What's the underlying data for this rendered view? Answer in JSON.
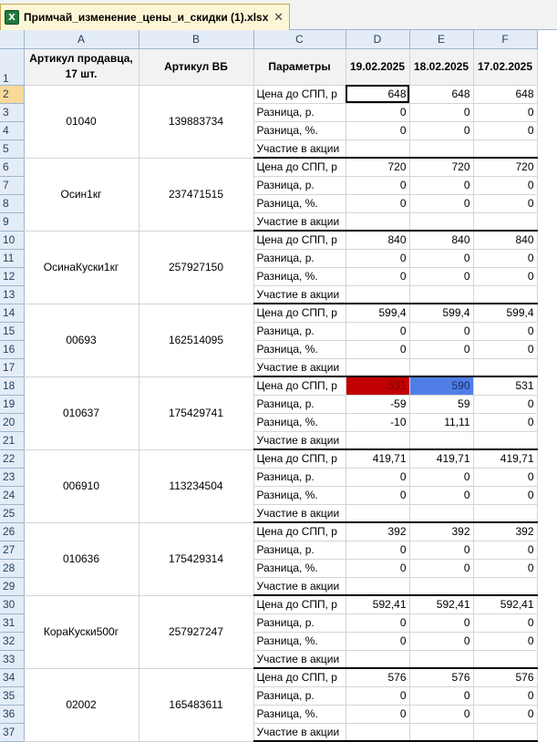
{
  "tab": {
    "title": "Примчай_изменение_цены_и_скидки (1).xlsx",
    "icon": "X",
    "close": "✕"
  },
  "columns": [
    "A",
    "B",
    "C",
    "D",
    "E",
    "F"
  ],
  "header": {
    "row": "1",
    "col_a": "Артикул продавца, 17 шт.",
    "col_b": "Артикул ВБ",
    "col_c": "Параметры",
    "dates": [
      "19.02.2025",
      "18.02.2025",
      "17.02.2025"
    ]
  },
  "param_labels": [
    "Цена до СПП, р",
    "Разница, р.",
    "Разница, %.",
    "Участие в акции"
  ],
  "groups": [
    {
      "rows": [
        "2",
        "3",
        "4",
        "5"
      ],
      "seller": "01040",
      "wb": "139883734",
      "values": [
        [
          "648",
          "648",
          "648"
        ],
        [
          "0",
          "0",
          "0"
        ],
        [
          "0",
          "0",
          "0"
        ],
        [
          "",
          "",
          ""
        ]
      ]
    },
    {
      "rows": [
        "6",
        "7",
        "8",
        "9"
      ],
      "seller": "Осин1кг",
      "wb": "237471515",
      "values": [
        [
          "720",
          "720",
          "720"
        ],
        [
          "0",
          "0",
          "0"
        ],
        [
          "0",
          "0",
          "0"
        ],
        [
          "",
          "",
          ""
        ]
      ]
    },
    {
      "rows": [
        "10",
        "11",
        "12",
        "13"
      ],
      "seller": "ОсинаКуски1кг",
      "wb": "257927150",
      "values": [
        [
          "840",
          "840",
          "840"
        ],
        [
          "0",
          "0",
          "0"
        ],
        [
          "0",
          "0",
          "0"
        ],
        [
          "",
          "",
          ""
        ]
      ]
    },
    {
      "rows": [
        "14",
        "15",
        "16",
        "17"
      ],
      "seller": "00693",
      "wb": "162514095",
      "values": [
        [
          "599,4",
          "599,4",
          "599,4"
        ],
        [
          "0",
          "0",
          "0"
        ],
        [
          "0",
          "0",
          "0"
        ],
        [
          "",
          "",
          ""
        ]
      ]
    },
    {
      "rows": [
        "18",
        "19",
        "20",
        "21"
      ],
      "seller": "010637",
      "wb": "175429741",
      "values": [
        [
          "531",
          "590",
          "531"
        ],
        [
          "-59",
          "59",
          "0"
        ],
        [
          "-10",
          "11,11",
          "0"
        ],
        [
          "",
          "",
          ""
        ]
      ]
    },
    {
      "rows": [
        "22",
        "23",
        "24",
        "25"
      ],
      "seller": "006910",
      "wb": "113234504",
      "values": [
        [
          "419,71",
          "419,71",
          "419,71"
        ],
        [
          "0",
          "0",
          "0"
        ],
        [
          "0",
          "0",
          "0"
        ],
        [
          "",
          "",
          ""
        ]
      ]
    },
    {
      "rows": [
        "26",
        "27",
        "28",
        "29"
      ],
      "seller": "010636",
      "wb": "175429314",
      "values": [
        [
          "392",
          "392",
          "392"
        ],
        [
          "0",
          "0",
          "0"
        ],
        [
          "0",
          "0",
          "0"
        ],
        [
          "",
          "",
          ""
        ]
      ]
    },
    {
      "rows": [
        "30",
        "31",
        "32",
        "33"
      ],
      "seller": "КораКуски500г",
      "wb": "257927247",
      "values": [
        [
          "592,41",
          "592,41",
          "592,41"
        ],
        [
          "0",
          "0",
          "0"
        ],
        [
          "0",
          "0",
          "0"
        ],
        [
          "",
          "",
          ""
        ]
      ]
    },
    {
      "rows": [
        "34",
        "35",
        "36",
        "37"
      ],
      "seller": "02002",
      "wb": "165483611",
      "values": [
        [
          "576",
          "576",
          "576"
        ],
        [
          "0",
          "0",
          "0"
        ],
        [
          "0",
          "0",
          "0"
        ],
        [
          "",
          "",
          ""
        ]
      ]
    }
  ],
  "highlights": {
    "decrease_color": "#c00000",
    "increase_color": "#4f7fe6",
    "header_fill": "#f2f2f2",
    "selected_row": "2"
  }
}
